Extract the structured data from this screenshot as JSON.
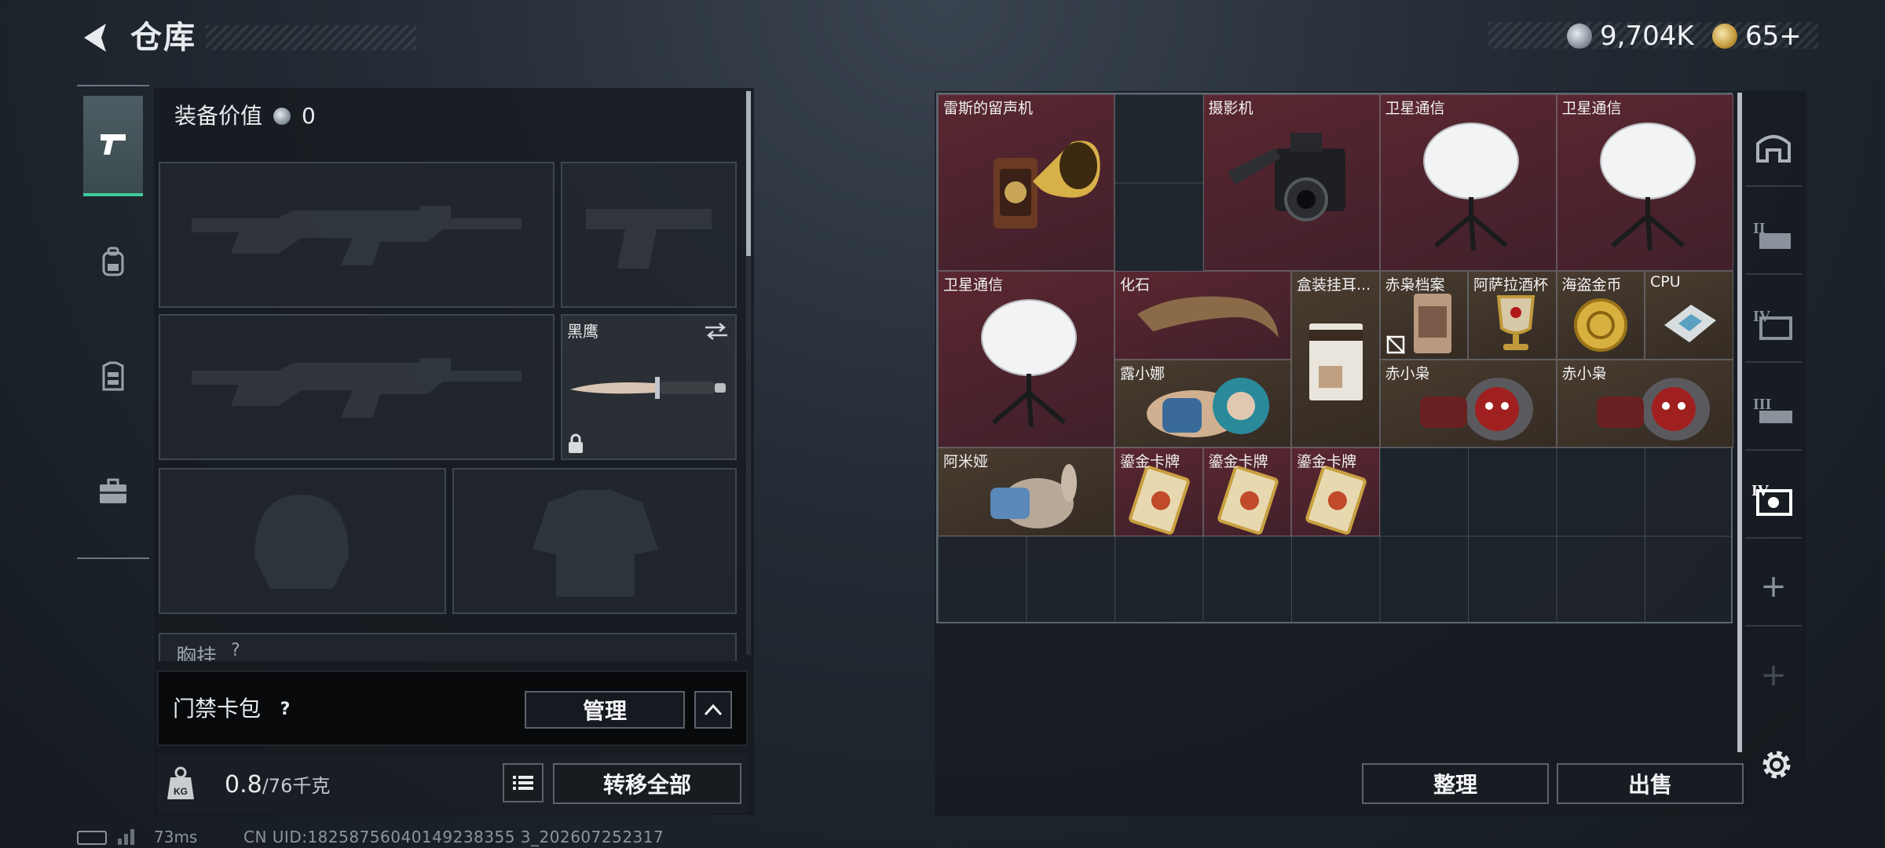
{
  "header": {
    "title": "仓库"
  },
  "currency": [
    {
      "icon": "silver-coin-icon",
      "value": "9,704K"
    },
    {
      "icon": "gold-coin-icon",
      "value": "65+"
    }
  ],
  "categories": [
    {
      "name": "weapons",
      "icon": "pistol-icon",
      "active": true
    },
    {
      "name": "backpack",
      "icon": "backpack-icon",
      "active": false
    },
    {
      "name": "chest-rig",
      "icon": "vest-icon",
      "active": false
    },
    {
      "name": "toolbox",
      "icon": "briefcase-icon",
      "active": false
    }
  ],
  "equipment": {
    "value_label": "装备价值",
    "value": "0",
    "melee": {
      "name": "黑鹰",
      "locked": true
    },
    "chest_rig_label": "胸挂",
    "chest_rig_help": "?"
  },
  "keycard": {
    "label": "门禁卡包",
    "help": "?",
    "manage_label": "管理"
  },
  "weight": {
    "current": "0.8",
    "max": "/76千克",
    "unit_icon": "KG"
  },
  "transfer_all_label": "转移全部",
  "stash": {
    "columns": 9,
    "rows": 6,
    "items": [
      {
        "name": "雷斯的留声机",
        "color": "red",
        "art": "gramophone"
      },
      {
        "name": "摄影机",
        "color": "red",
        "art": "camera"
      },
      {
        "name": "卫星通信",
        "color": "red",
        "art": "satellite"
      },
      {
        "name": "卫星通信",
        "color": "red",
        "art": "satellite"
      },
      {
        "name": "卫星通信",
        "color": "red",
        "art": "satellite"
      },
      {
        "name": "化石",
        "color": "red",
        "art": "fossil"
      },
      {
        "name": "盒装挂耳...",
        "color": "brown",
        "art": "coffee-box"
      },
      {
        "name": "赤枭档案",
        "color": "brown",
        "art": "archive"
      },
      {
        "name": "阿萨拉酒杯",
        "color": "brown",
        "art": "goblet"
      },
      {
        "name": "海盗金币",
        "color": "brown",
        "art": "gold-coin"
      },
      {
        "name": "CPU",
        "color": "brown",
        "art": "cpu"
      },
      {
        "name": "露小娜",
        "color": "brown",
        "art": "doll"
      },
      {
        "name": "赤小枭",
        "color": "brown",
        "art": "owl-figure"
      },
      {
        "name": "赤小枭",
        "color": "brown",
        "art": "owl-figure"
      },
      {
        "name": "阿米娅",
        "color": "brown",
        "art": "bunny-doll"
      },
      {
        "name": "鎏金卡牌",
        "color": "red",
        "art": "gold-card"
      },
      {
        "name": "鎏金卡牌",
        "color": "red",
        "art": "gold-card"
      },
      {
        "name": "鎏金卡牌",
        "color": "red",
        "art": "gold-card"
      }
    ]
  },
  "stash_tabs": [
    {
      "label": "",
      "icon": "home-icon"
    },
    {
      "label": "II",
      "icon": "stash-tab-2-icon"
    },
    {
      "label": "IV",
      "icon": "stash-tab-4-icon"
    },
    {
      "label": "III",
      "icon": "stash-tab-3-icon"
    },
    {
      "label": "IV",
      "icon": "stash-tab-active-icon",
      "active": true
    },
    {
      "label": "+",
      "icon": "add-tab-icon"
    },
    {
      "label": "+",
      "icon": "add-tab-icon"
    }
  ],
  "actions": {
    "sort_label": "整理",
    "sell_label": "出售"
  },
  "footer": {
    "ping": "73ms",
    "uid": "CN UID:18258756040149238355 3_202607252317"
  },
  "colors": {
    "accent": "#3ec99a",
    "red_rarity": "#4f2530",
    "brown_rarity": "#3f342a"
  }
}
